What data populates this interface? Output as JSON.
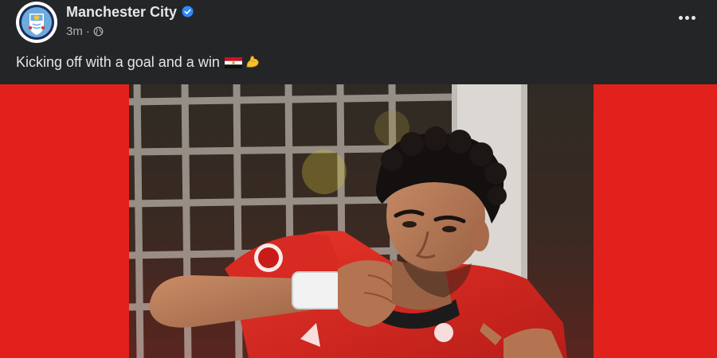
{
  "post": {
    "page_name": "Manchester City",
    "timestamp": "3m",
    "separator": "·",
    "audience_icon": "globe-icon",
    "more_icon": "more-horizontal-icon",
    "caption": "Kicking off with a goal and a win",
    "caption_emojis": [
      "egypt-flag-icon",
      "muscle-icon"
    ]
  },
  "colors": {
    "background": "#242526",
    "brand_red": "#e3211c",
    "verified_blue": "#2d88ff",
    "city_blue": "#6cabdd"
  }
}
